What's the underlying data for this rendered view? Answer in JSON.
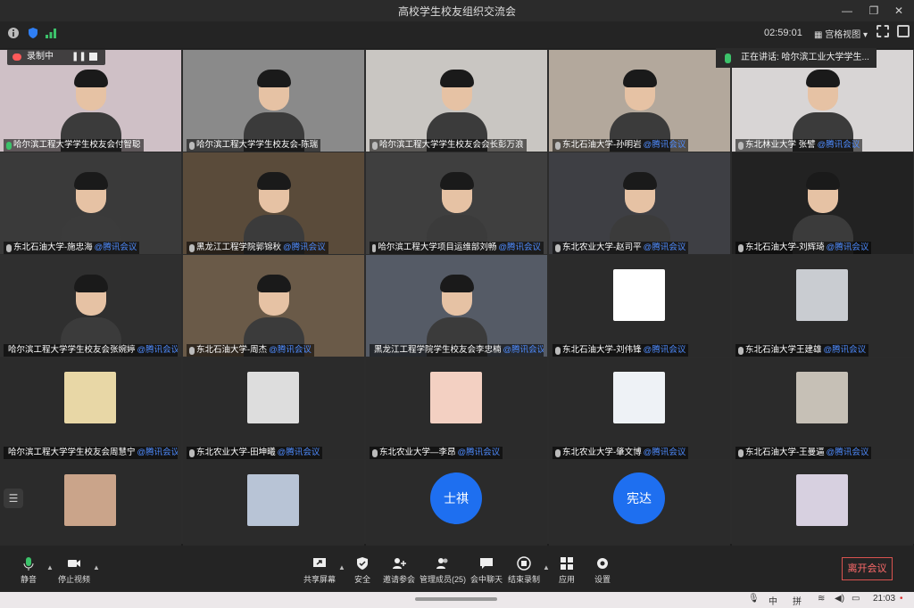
{
  "window": {
    "title": "高校学生校友组织交流会"
  },
  "infobar": {
    "timer": "02:59:01",
    "view_label": "宫格视图",
    "view_caret": "▾"
  },
  "recording": {
    "label": "录制中"
  },
  "speaking": {
    "label": "正在讲话: 哈尔滨工业大学学生..."
  },
  "tag": "@腾讯会议",
  "tiles": [
    {
      "name": "哈尔滨工程大学学生校友会付智聪",
      "tag": "",
      "host": true
    },
    {
      "name": "哈尔滨工程大学学生校友会-陈瑞",
      "tag": "",
      "host": true
    },
    {
      "name": "哈尔滨工程大学学生校友会会长彭万浪",
      "tag": "",
      "host": false
    },
    {
      "name": "东北石油大学-孙明岩",
      "tag": "@腾讯会议",
      "host": false
    },
    {
      "name": "东北林业大学 张譬",
      "tag": "@腾讯会议",
      "host": false
    },
    {
      "name": "东北石油大学-施忠海",
      "tag": "@腾讯会议",
      "host": false
    },
    {
      "name": "黑龙江工程学院郭锦秋",
      "tag": "@腾讯会议",
      "host": false
    },
    {
      "name": "哈尔滨工程大学项目运维部刘畅",
      "tag": "@腾讯会议",
      "host": false
    },
    {
      "name": "东北农业大学-赵司平",
      "tag": "@腾讯会议",
      "host": false
    },
    {
      "name": "东北石油大学-刘辉琦",
      "tag": "@腾讯会议",
      "host": false
    },
    {
      "name": "哈尔滨工程大学学生校友会张婉婷",
      "tag": "@腾讯会议",
      "host": false
    },
    {
      "name": "东北石油大学-周杰",
      "tag": "@腾讯会议",
      "host": false
    },
    {
      "name": "黑龙江工程学院学生校友会李忠楠",
      "tag": "@腾讯会议",
      "host": false
    },
    {
      "name": "东北石油大学-刘伟锋",
      "tag": "@腾讯会议",
      "host": false
    },
    {
      "name": "东北石油大学王建雄",
      "tag": "@腾讯会议",
      "host": false
    },
    {
      "name": "哈尔滨工程大学学生校友会周慧宁",
      "tag": "@腾讯会议",
      "host": false
    },
    {
      "name": "东北农业大学-田坤曦",
      "tag": "@腾讯会议",
      "host": false
    },
    {
      "name": "东北农业大学—李昂",
      "tag": "@腾讯会议",
      "host": false
    },
    {
      "name": "东北农业大学-肇文博",
      "tag": "@腾讯会议",
      "host": false
    },
    {
      "name": "东北石油大学-王曼逼",
      "tag": "@腾讯会议",
      "host": false
    },
    {
      "name": "",
      "tag": "",
      "host": false
    },
    {
      "name": "",
      "tag": "",
      "host": false
    },
    {
      "name": "",
      "tag": "",
      "host": false,
      "initials": "士祺"
    },
    {
      "name": "",
      "tag": "",
      "host": false,
      "initials": "宪达"
    },
    {
      "name": "",
      "tag": "",
      "host": false
    }
  ],
  "toolbar": {
    "mute": "静音",
    "stop_video": "停止视频",
    "share": "共享屏幕",
    "security": "安全",
    "invite": "邀请参会",
    "members": "管理成员(25)",
    "chat": "会中聊天",
    "end_record": "结束录制",
    "apps": "应用",
    "settings": "设置",
    "leave": "离开会议"
  },
  "taskbar": {
    "ime1": "中",
    "ime2": "拼",
    "time": "21:03"
  },
  "colors": {
    "accent": "#1e6ff0",
    "leave": "#d9534f",
    "active_mic": "#3cc26a"
  }
}
